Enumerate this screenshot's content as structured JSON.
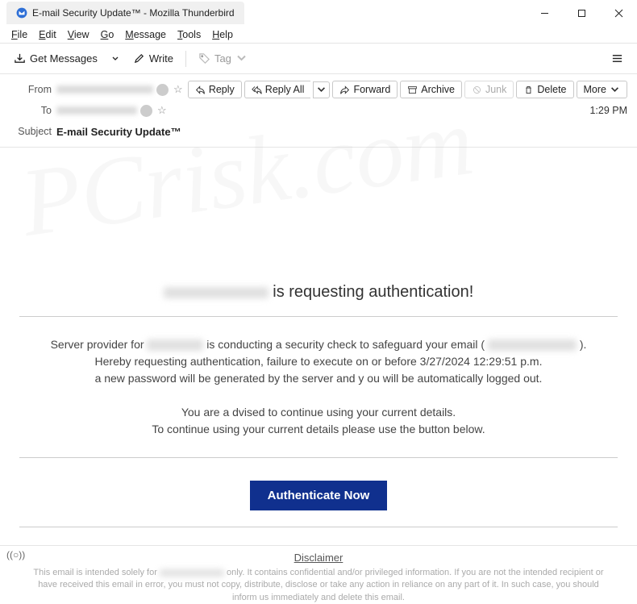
{
  "window": {
    "tab_title": "E-mail Security Update™ - Mozilla Thunderbird"
  },
  "menu": {
    "file": "File",
    "edit": "Edit",
    "view": "View",
    "go": "Go",
    "message": "Message",
    "tools": "Tools",
    "help": "Help"
  },
  "toolbar": {
    "get_messages": "Get Messages",
    "write": "Write",
    "tag": "Tag"
  },
  "headers": {
    "from_label": "From",
    "to_label": "To",
    "subject_label": "Subject",
    "subject_value": "E-mail Security Update™",
    "time": "1:29 PM"
  },
  "actions": {
    "reply": "Reply",
    "reply_all": "Reply All",
    "forward": "Forward",
    "archive": "Archive",
    "junk": "Junk",
    "delete": "Delete",
    "more": "More"
  },
  "email": {
    "heading_suffix": " is requesting authentication!",
    "line1_prefix": "Server provider for ",
    "line1_middle": " is conducting a security check to safeguard your email ( ",
    "line1_suffix": " ).",
    "line2": "Hereby requesting authentication, failure to execute on or before 3/27/2024 12:29:51 p.m.",
    "line3": "a new password will be generated by the server and y ou will be automatically logged out.",
    "line4": "You are a dvised to continue using your current details.",
    "line5": "To continue using your current details please use the button below.",
    "button": "Authenticate Now",
    "disclaimer_title": "Disclaimer",
    "disclaimer_prefix": "This email is intended solely for ",
    "disclaimer_suffix": " only. It contains confidential and/or privileged information. If you are not the intended recipient or have received this email in error, you must not copy, distribute, disclose or take any action in reliance on any part of it. In such case, you should inform us immediately and delete this email."
  },
  "status": {
    "indicator": "((○))"
  }
}
